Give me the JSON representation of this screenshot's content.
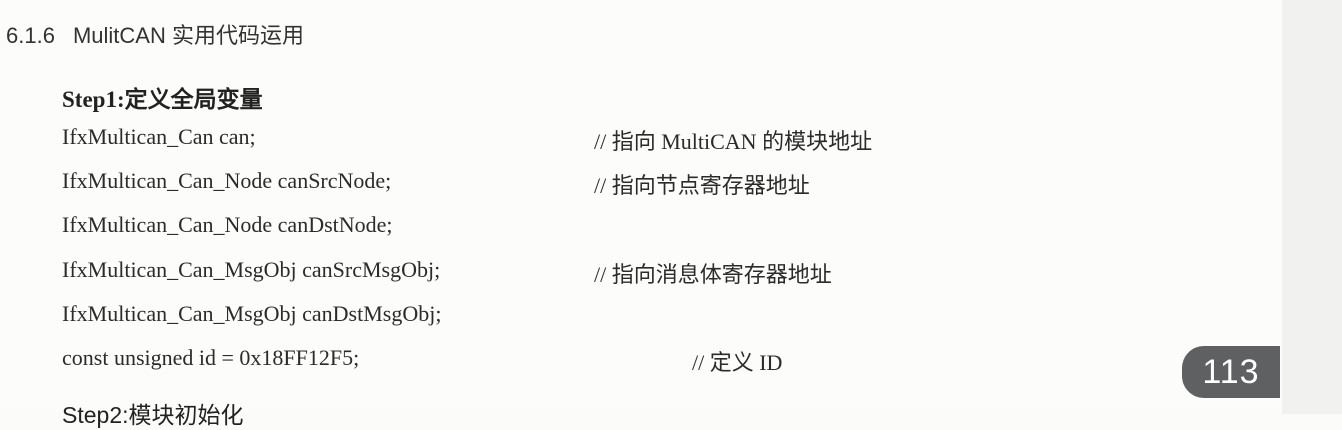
{
  "section": {
    "number": "6.1.6",
    "title": "MulitCAN 实用代码运用"
  },
  "step1": {
    "heading": "Step1:定义全局变量"
  },
  "code": [
    {
      "text": "IfxMultican_Can can;",
      "comment": "// 指向 MultiCAN 的模块地址"
    },
    {
      "text": "IfxMultican_Can_Node  canSrcNode;",
      "comment": "// 指向节点寄存器地址"
    },
    {
      "text": "IfxMultican_Can_Node  canDstNode;",
      "comment": ""
    },
    {
      "text": "IfxMultican_Can_MsgObj  canSrcMsgObj;",
      "comment": "// 指向消息体寄存器地址"
    },
    {
      "text": "IfxMultican_Can_MsgObj  canDstMsgObj;",
      "comment": ""
    },
    {
      "text": "const unsigned id = 0x18FF12F5;",
      "comment": "// 定义 ID"
    }
  ],
  "step2": {
    "heading": "Step2:模块初始化"
  },
  "page_number": "113"
}
